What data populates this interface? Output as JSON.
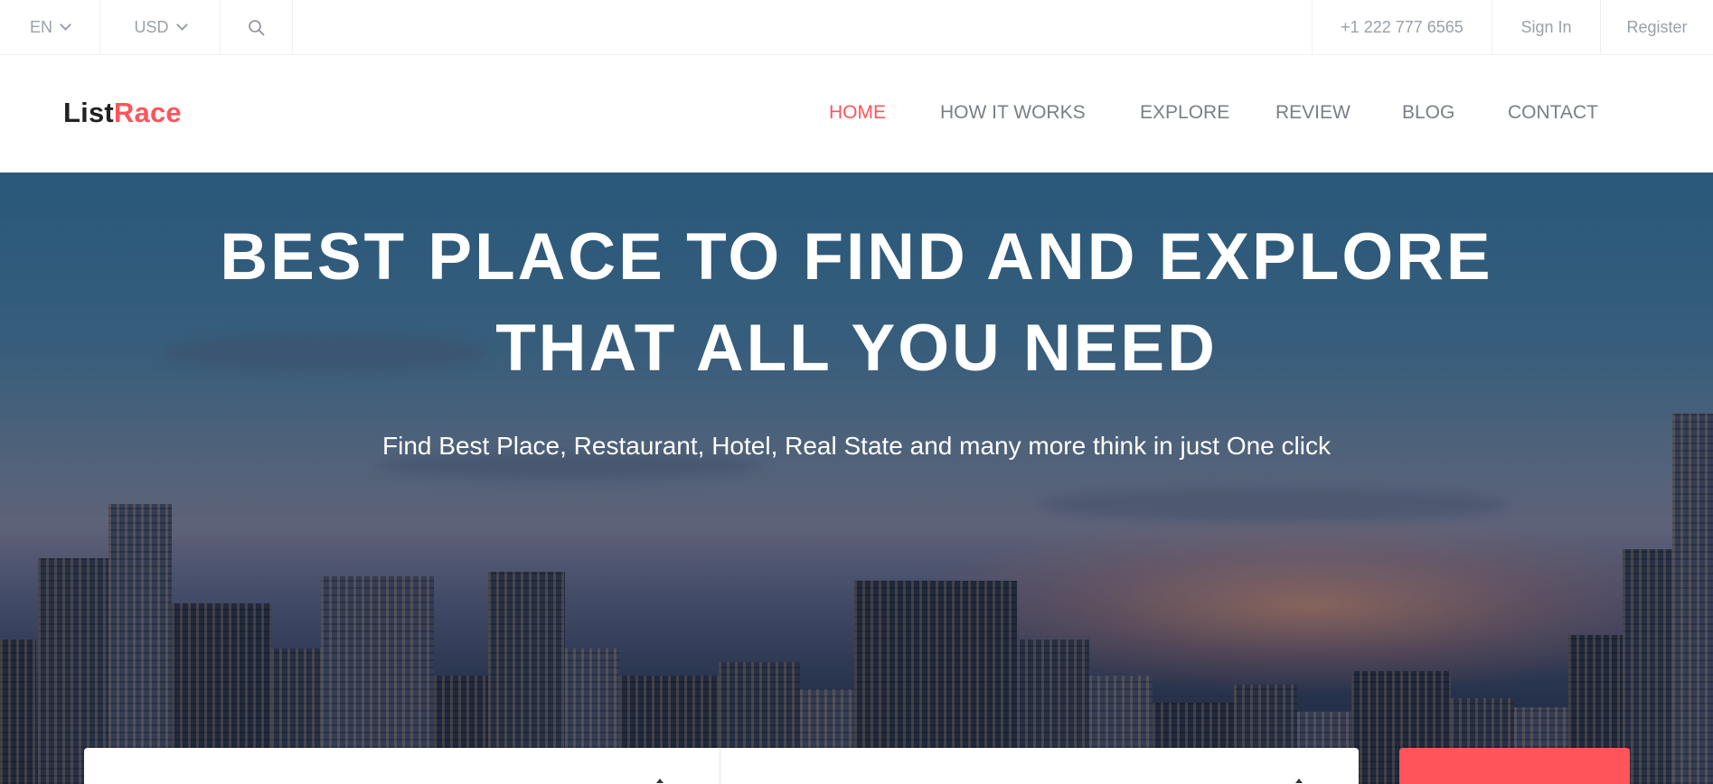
{
  "topbar": {
    "language": "EN",
    "currency": "USD",
    "search_icon": "search-icon",
    "phone": "+1 222 777 6565",
    "sign_in": "Sign In",
    "register": "Register"
  },
  "brand": {
    "logo_part1": "List",
    "logo_part2": "Race",
    "accent_color": "#ff545a"
  },
  "nav": {
    "items": [
      {
        "label": "HOME",
        "active": true
      },
      {
        "label": "HOW IT WORKS",
        "active": false
      },
      {
        "label": "EXPLORE",
        "active": false
      },
      {
        "label": "REVIEW",
        "active": false
      },
      {
        "label": "BLOG",
        "active": false
      },
      {
        "label": "CONTACT",
        "active": false
      }
    ]
  },
  "hero": {
    "title_line1": "BEST PLACE TO FIND AND EXPLORE",
    "title_line2": "THAT ALL YOU NEED",
    "subtitle": "Find Best Place, Restaurant, Hotel, Real State and many more think in just One click"
  }
}
